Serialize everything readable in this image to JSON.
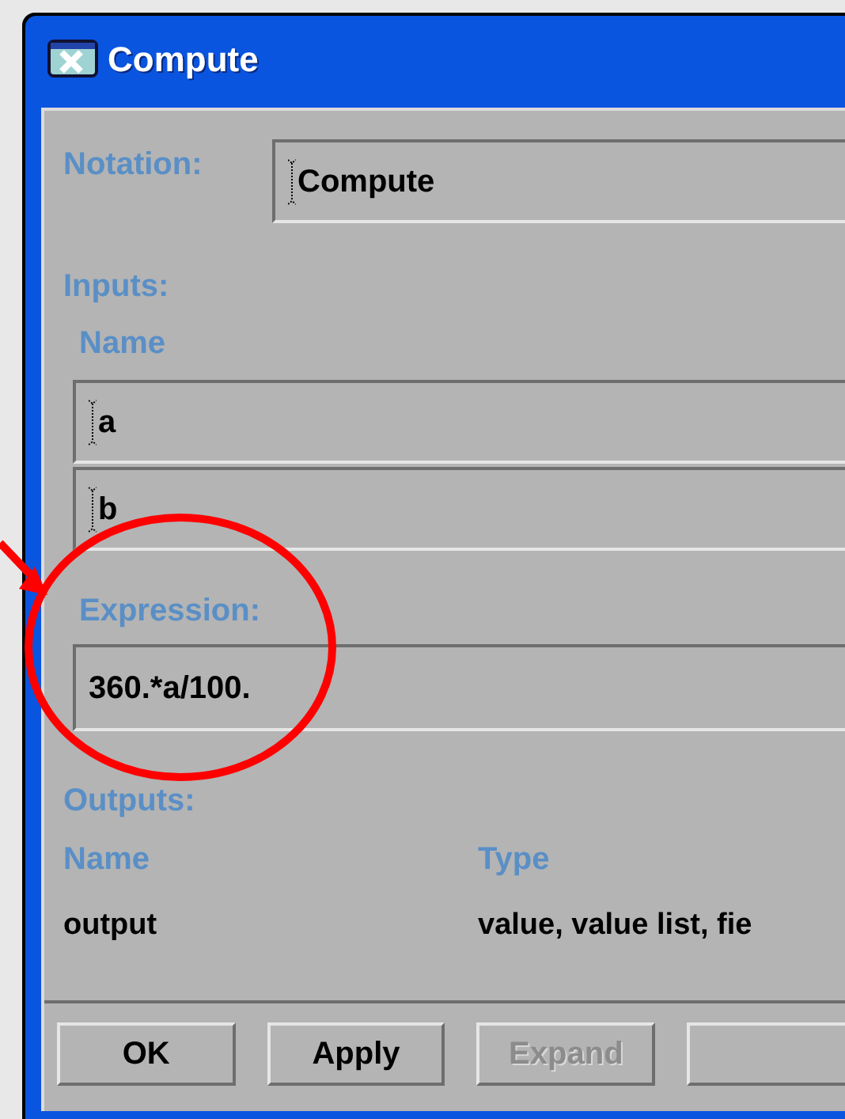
{
  "window": {
    "title": "Compute"
  },
  "notation": {
    "label": "Notation:",
    "value": "Compute"
  },
  "inputs": {
    "label": "Inputs:",
    "column": "Name",
    "rows": [
      "a",
      "b"
    ]
  },
  "expression": {
    "label": "Expression:",
    "value": "360.*a/100."
  },
  "outputs": {
    "label": "Outputs:",
    "columns": [
      "Name",
      "Type"
    ],
    "rows": [
      {
        "name": "output",
        "type": "value, value list, fie"
      }
    ]
  },
  "buttons": [
    {
      "label": "OK",
      "disabled": false
    },
    {
      "label": "Apply",
      "disabled": false
    },
    {
      "label": "Expand",
      "disabled": true
    }
  ]
}
